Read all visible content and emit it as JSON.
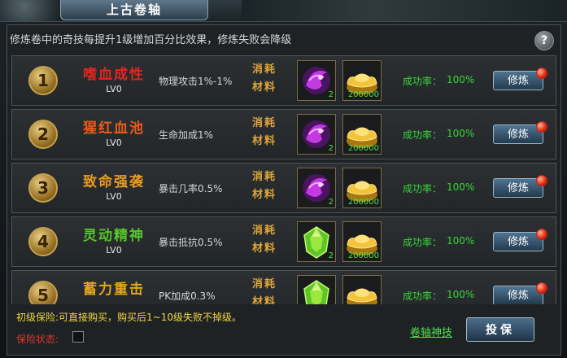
{
  "window": {
    "title": "上古卷轴"
  },
  "notice": "修炼卷中的奇技每提升1级增加百分比效果，修炼失败会降级",
  "help_icon": "?",
  "material_label": "消耗材料",
  "rate_label": "成功率：",
  "skills": [
    {
      "index": "1",
      "name": "嗜血成性",
      "name_color": "#e2261e",
      "level": "LV0",
      "effect": "物理攻击1%-1%",
      "item": "purple-scroll-icon",
      "item_count": "2",
      "gold": "200000",
      "rate": "100%",
      "button": "修炼"
    },
    {
      "index": "2",
      "name": "猩红血池",
      "name_color": "#e95b1a",
      "level": "LV0",
      "effect": "生命加成1%",
      "item": "purple-scroll-icon",
      "item_count": "2",
      "gold": "200000",
      "rate": "100%",
      "button": "修炼"
    },
    {
      "index": "3",
      "name": "致命强袭",
      "name_color": "#e99a1e",
      "level": "LV0",
      "effect": "暴击几率0.5%",
      "item": "purple-scroll-icon",
      "item_count": "2",
      "gold": "200000",
      "rate": "100%",
      "button": "修炼"
    },
    {
      "index": "4",
      "name": "灵动精神",
      "name_color": "#56c62a",
      "level": "LV0",
      "effect": "暴击抵抗0.5%",
      "item": "green-gem-icon",
      "item_count": "2",
      "gold": "200000",
      "rate": "100%",
      "button": "修炼"
    },
    {
      "index": "5",
      "name": "蓄力重击",
      "name_color": "#e4a61d",
      "level": "",
      "effect": "PK加成0.3%",
      "item": "green-gem-icon",
      "item_count": "",
      "gold": "",
      "rate": "100%",
      "button": "修炼"
    }
  ],
  "footer": {
    "insurance_info": "初级保险:可直接购买，购买后1~10级失败不掉级。",
    "insurance_status_label": "保险状态:",
    "scroll_skill_link": "卷轴神技",
    "insure_button": "投保"
  },
  "colors": {
    "gold": "#e0a63a",
    "green": "#38d638",
    "red": "#e23a2a"
  }
}
